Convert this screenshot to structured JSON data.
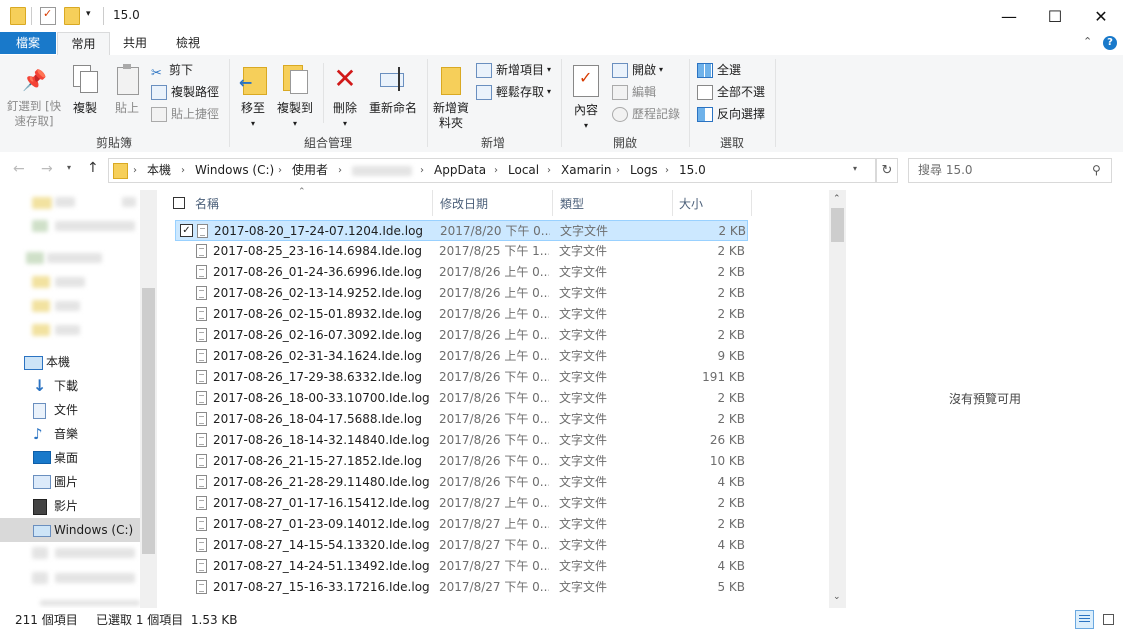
{
  "window": {
    "title": "15.0",
    "minimize": "—",
    "maximize": "☐",
    "close": "✕"
  },
  "tabs": {
    "file": "檔案",
    "home": "常用",
    "share": "共用",
    "view": "檢視"
  },
  "ribbon": {
    "clipboard": {
      "label": "剪貼簿",
      "pin": "釘選到 [快速存取]",
      "copy": "複製",
      "paste": "貼上",
      "cut": "剪下",
      "copy_path": "複製路徑",
      "paste_shortcut": "貼上捷徑"
    },
    "organize": {
      "label": "組合管理",
      "move_to": "移至",
      "copy_to": "複製到",
      "delete": "刪除",
      "rename": "重新命名"
    },
    "new": {
      "label": "新增",
      "new_folder": "新增資料夾",
      "new_item": "新增項目",
      "easy_access": "輕鬆存取"
    },
    "open": {
      "label": "開啟",
      "properties": "內容",
      "open": "開啟",
      "edit": "編輯",
      "history": "歷程記錄"
    },
    "select": {
      "label": "選取",
      "select_all": "全選",
      "select_none": "全部不選",
      "invert": "反向選擇"
    }
  },
  "address": {
    "crumbs": [
      "本機",
      "Windows (C:)",
      "使用者",
      "AppData",
      "Local",
      "Xamarin",
      "Logs",
      "15.0"
    ],
    "search_placeholder": "搜尋 15.0"
  },
  "nav": {
    "this_pc": "本機",
    "items": [
      "下載",
      "文件",
      "音樂",
      "桌面",
      "圖片",
      "影片",
      "Windows (C:)"
    ]
  },
  "columns": {
    "name": "名稱",
    "date": "修改日期",
    "type": "類型",
    "size": "大小"
  },
  "files": [
    {
      "name": "2017-08-20_17-24-07.1204.Ide.log",
      "date": "2017/8/20 下午 0...",
      "type": "文字文件",
      "size": "2 KB",
      "selected": true
    },
    {
      "name": "2017-08-25_23-16-14.6984.Ide.log",
      "date": "2017/8/25 下午 1...",
      "type": "文字文件",
      "size": "2 KB"
    },
    {
      "name": "2017-08-26_01-24-36.6996.Ide.log",
      "date": "2017/8/26 上午 0...",
      "type": "文字文件",
      "size": "2 KB"
    },
    {
      "name": "2017-08-26_02-13-14.9252.Ide.log",
      "date": "2017/8/26 上午 0...",
      "type": "文字文件",
      "size": "2 KB"
    },
    {
      "name": "2017-08-26_02-15-01.8932.Ide.log",
      "date": "2017/8/26 上午 0...",
      "type": "文字文件",
      "size": "2 KB"
    },
    {
      "name": "2017-08-26_02-16-07.3092.Ide.log",
      "date": "2017/8/26 上午 0...",
      "type": "文字文件",
      "size": "2 KB"
    },
    {
      "name": "2017-08-26_02-31-34.1624.Ide.log",
      "date": "2017/8/26 上午 0...",
      "type": "文字文件",
      "size": "9 KB"
    },
    {
      "name": "2017-08-26_17-29-38.6332.Ide.log",
      "date": "2017/8/26 下午 0...",
      "type": "文字文件",
      "size": "191 KB"
    },
    {
      "name": "2017-08-26_18-00-33.10700.Ide.log",
      "date": "2017/8/26 下午 0...",
      "type": "文字文件",
      "size": "2 KB"
    },
    {
      "name": "2017-08-26_18-04-17.5688.Ide.log",
      "date": "2017/8/26 下午 0...",
      "type": "文字文件",
      "size": "2 KB"
    },
    {
      "name": "2017-08-26_18-14-32.14840.Ide.log",
      "date": "2017/8/26 下午 0...",
      "type": "文字文件",
      "size": "26 KB"
    },
    {
      "name": "2017-08-26_21-15-27.1852.Ide.log",
      "date": "2017/8/26 下午 0...",
      "type": "文字文件",
      "size": "10 KB"
    },
    {
      "name": "2017-08-26_21-28-29.11480.Ide.log",
      "date": "2017/8/26 下午 0...",
      "type": "文字文件",
      "size": "4 KB"
    },
    {
      "name": "2017-08-27_01-17-16.15412.Ide.log",
      "date": "2017/8/27 上午 0...",
      "type": "文字文件",
      "size": "2 KB"
    },
    {
      "name": "2017-08-27_01-23-09.14012.Ide.log",
      "date": "2017/8/27 上午 0...",
      "type": "文字文件",
      "size": "2 KB"
    },
    {
      "name": "2017-08-27_14-15-54.13320.Ide.log",
      "date": "2017/8/27 下午 0...",
      "type": "文字文件",
      "size": "4 KB"
    },
    {
      "name": "2017-08-27_14-24-51.13492.Ide.log",
      "date": "2017/8/27 下午 0...",
      "type": "文字文件",
      "size": "4 KB"
    },
    {
      "name": "2017-08-27_15-16-33.17216.Ide.log",
      "date": "2017/8/27 下午 0...",
      "type": "文字文件",
      "size": "5 KB"
    }
  ],
  "preview": {
    "text": "沒有預覽可用"
  },
  "status": {
    "count": "211 個項目",
    "selected": "已選取 1 個項目  1.53 KB"
  },
  "colors": {
    "accent": "#1979ca",
    "selection": "#cce8ff"
  }
}
